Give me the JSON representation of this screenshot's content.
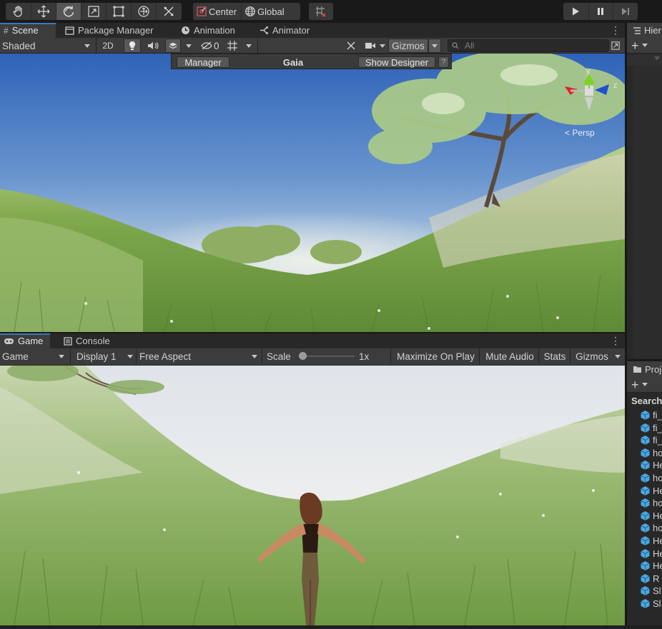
{
  "toolbar": {
    "tools": [
      "hand-tool",
      "move-tool",
      "rotate-tool",
      "scale-tool",
      "rect-tool",
      "transform-tool",
      "custom-tool"
    ],
    "pivot_label": "Center",
    "space_label": "Global"
  },
  "scene_panel": {
    "tabs": [
      "Scene",
      "Package Manager",
      "Animation",
      "Animator"
    ],
    "draw_mode": "Shaded",
    "mode_2d": "2D",
    "hidden_count": "0",
    "gizmos_label": "Gizmos",
    "search_placeholder": "All",
    "projection_label": "< Persp",
    "axis_labels": {
      "y": "y",
      "z": "z"
    }
  },
  "gaia": {
    "manager_label": "Manager",
    "title": "Gaia",
    "designer_label": "Show Designer",
    "help_label": "?"
  },
  "game_panel": {
    "tabs": [
      "Game",
      "Console"
    ],
    "view_mode": "Game",
    "display": "Display 1",
    "aspect": "Free Aspect",
    "scale_label": "Scale",
    "scale_value": "1x",
    "scale_fraction": 0,
    "maximize_label": "Maximize On Play",
    "mute_label": "Mute Audio",
    "stats_label": "Stats",
    "gizmos_label": "Gizmos"
  },
  "hierarchy": {
    "tab_label": "Hier"
  },
  "project": {
    "tab_label": "Proj",
    "search_label": "Search",
    "items": [
      "fi_",
      "fi_",
      "fi_",
      "ho",
      "He",
      "ho",
      "He",
      "ho",
      "He",
      "ho",
      "He",
      "He",
      "He",
      "R",
      "Sl",
      "Sl"
    ]
  },
  "colors": {
    "accent": "#3a79bb",
    "panel_bg": "#282828",
    "toolbar_bg": "#3c3c3c",
    "prefab_blue": "#4aa8e0"
  }
}
